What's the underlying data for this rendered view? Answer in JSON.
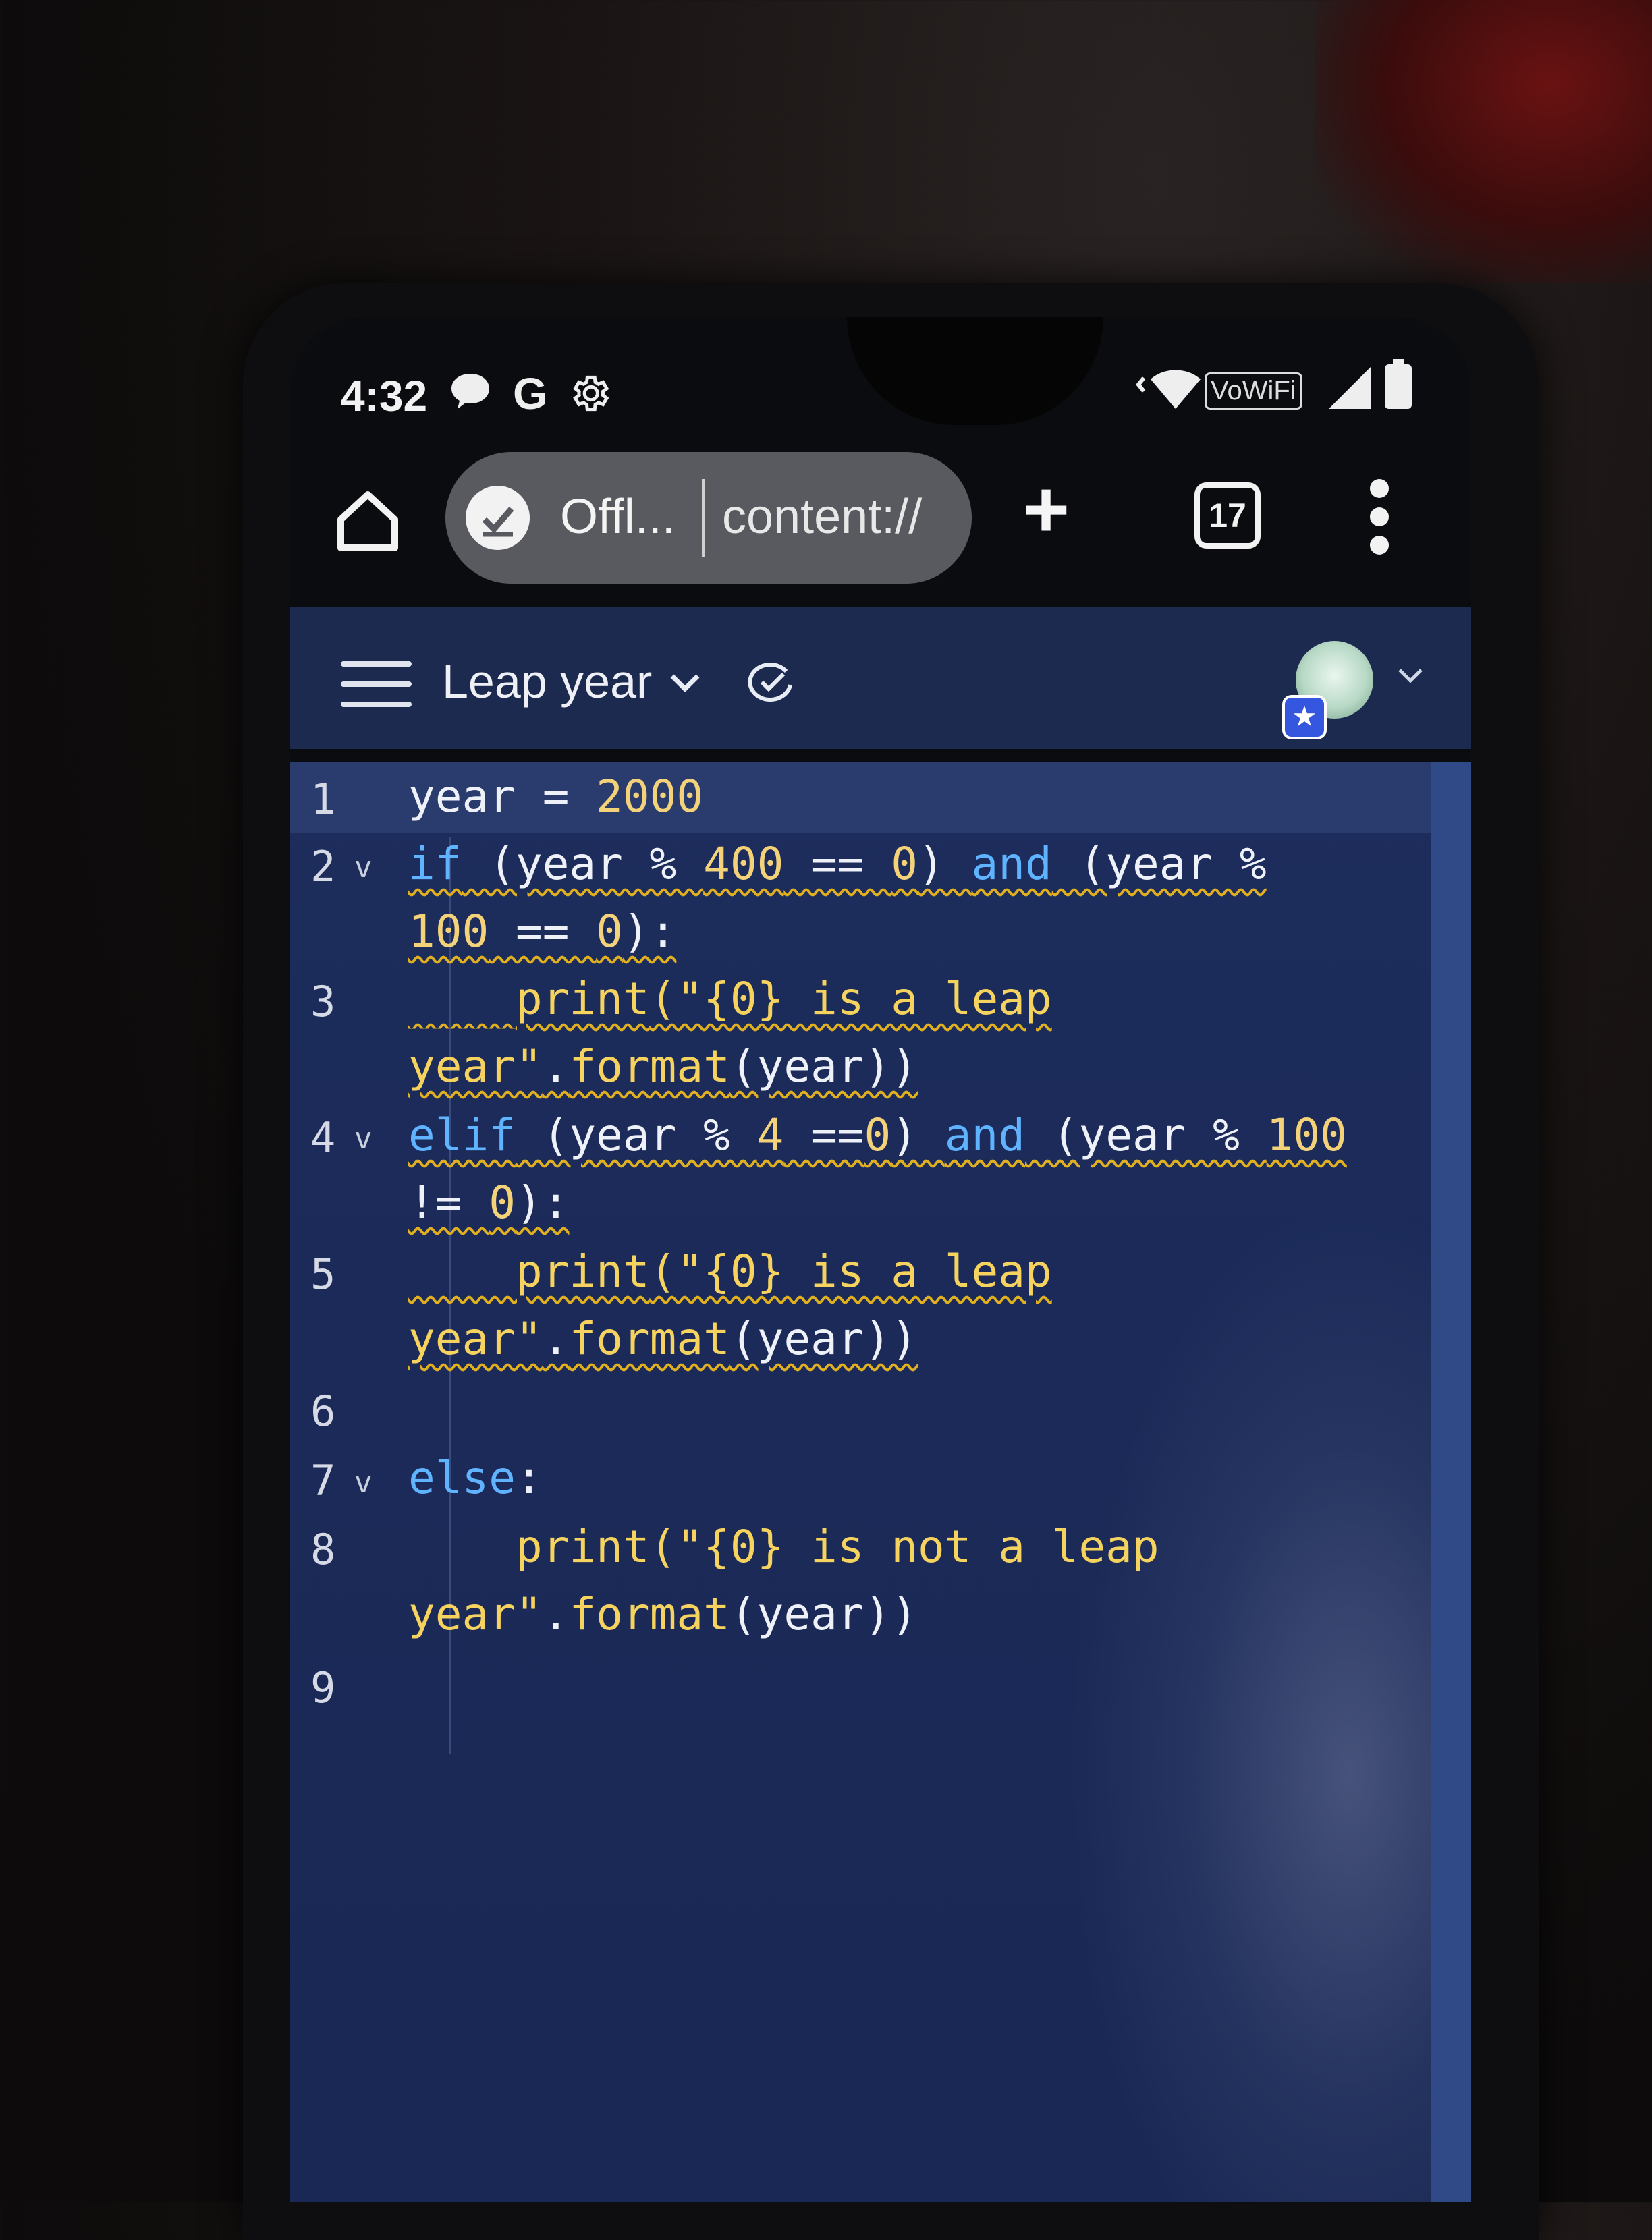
{
  "status_bar": {
    "time": "4:32",
    "network_label": "VoWiFi"
  },
  "browser": {
    "url_status": "Offl...",
    "url_text": "content://",
    "tab_count": "17",
    "icons": [
      "home-icon",
      "offline-check-icon",
      "new-tab-icon",
      "tab-switcher-icon",
      "overflow-menu-icon"
    ]
  },
  "app": {
    "title": "Leap year",
    "icons": [
      "hamburger-menu-icon",
      "chevron-down-icon",
      "sync-check-icon",
      "avatar",
      "chevron-down-icon"
    ]
  },
  "editor": {
    "line_numbers": [
      "1",
      "2",
      "3",
      "4",
      "5",
      "6",
      "7",
      "8",
      "9"
    ],
    "lines": {
      "l1": {
        "var": "year",
        "op": " = ",
        "val": "2000"
      },
      "l2a": {
        "kw": "if",
        "rest1": " (year % ",
        "n1": "400",
        "rest2": " == ",
        "n2": "0",
        "rest3": ") ",
        "kw2": "and",
        "rest4": " (year %"
      },
      "l2b": {
        "n1": "100",
        "rest": " == ",
        "n2": "0",
        "end": "):"
      },
      "l3a": {
        "indent": "    ",
        "fn": "print",
        "str": "(\"{0} is a leap"
      },
      "l3b": {
        "str": "year\"",
        "rest": ".",
        "fn": "format",
        "end": "(year))"
      },
      "l4a": {
        "kw": "elif",
        "rest1": " (year % ",
        "n1": "4",
        "rest2": " ==",
        "n2": "0",
        "rest3": ") ",
        "kw2": "and",
        "rest4": " (year % ",
        "n3": "100"
      },
      "l4b": {
        "rest": "!= ",
        "n": "0",
        "end": "):"
      },
      "l5a": {
        "indent": "    ",
        "fn": "print",
        "str": "(\"{0} is a leap"
      },
      "l5b": {
        "str": "year\"",
        "rest": ".",
        "fn": "format",
        "end": "(year))"
      },
      "l7": {
        "kw": "else",
        "end": ":"
      },
      "l8a": {
        "indent": "    ",
        "fn": "print",
        "str": "(\"{0} is not a leap"
      },
      "l8b": {
        "str": "year\"",
        "rest": ".",
        "fn": "format",
        "end": "(year))"
      }
    }
  }
}
